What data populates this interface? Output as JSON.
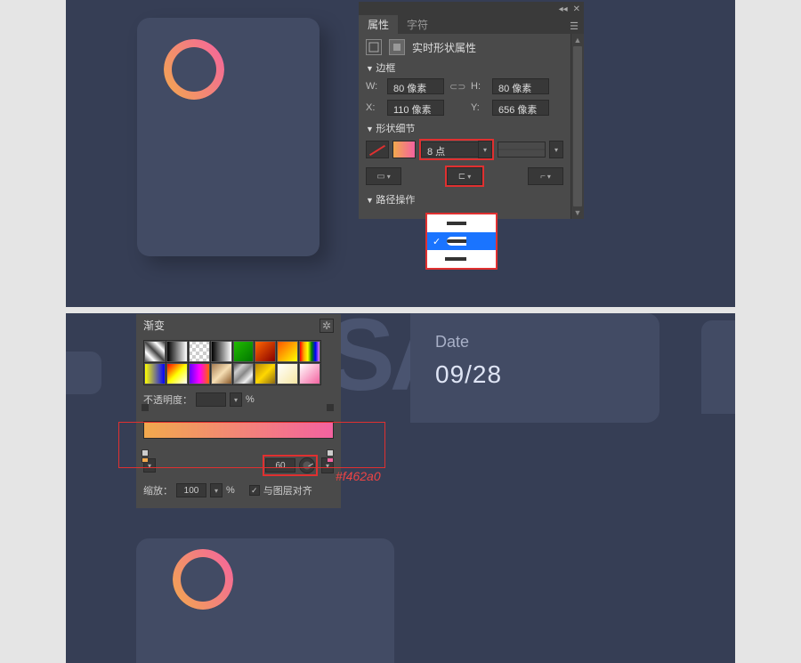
{
  "properties_panel": {
    "tab_active": "属性",
    "tab_inactive": "字符",
    "header_title": "实时形状属性",
    "section_bounds": "边框",
    "w_label": "W:",
    "w_value": "80 像素",
    "h_label": "H:",
    "h_value": "80 像素",
    "x_label": "X:",
    "x_value": "110 像素",
    "y_label": "Y:",
    "y_value": "656 像素",
    "section_shape": "形状细节",
    "stroke_width": "8 点",
    "section_path": "路径操作",
    "cap_options": [
      "butt",
      "round",
      "square"
    ],
    "cap_selected_index": 1
  },
  "gradient_panel": {
    "title": "渐变",
    "opacity_label": "不透明度：",
    "opacity_unit": "%",
    "angle_value": "60",
    "scale_label": "缩放：",
    "scale_value": "100",
    "scale_unit": "%",
    "align_label": "与图层对齐",
    "align_checked": true,
    "stop_color_right": "#f462a0",
    "stop_color_left": "#f2a94d"
  },
  "date_card": {
    "label": "Date",
    "value": "09/28"
  },
  "annotation_hex": "#f462a0"
}
